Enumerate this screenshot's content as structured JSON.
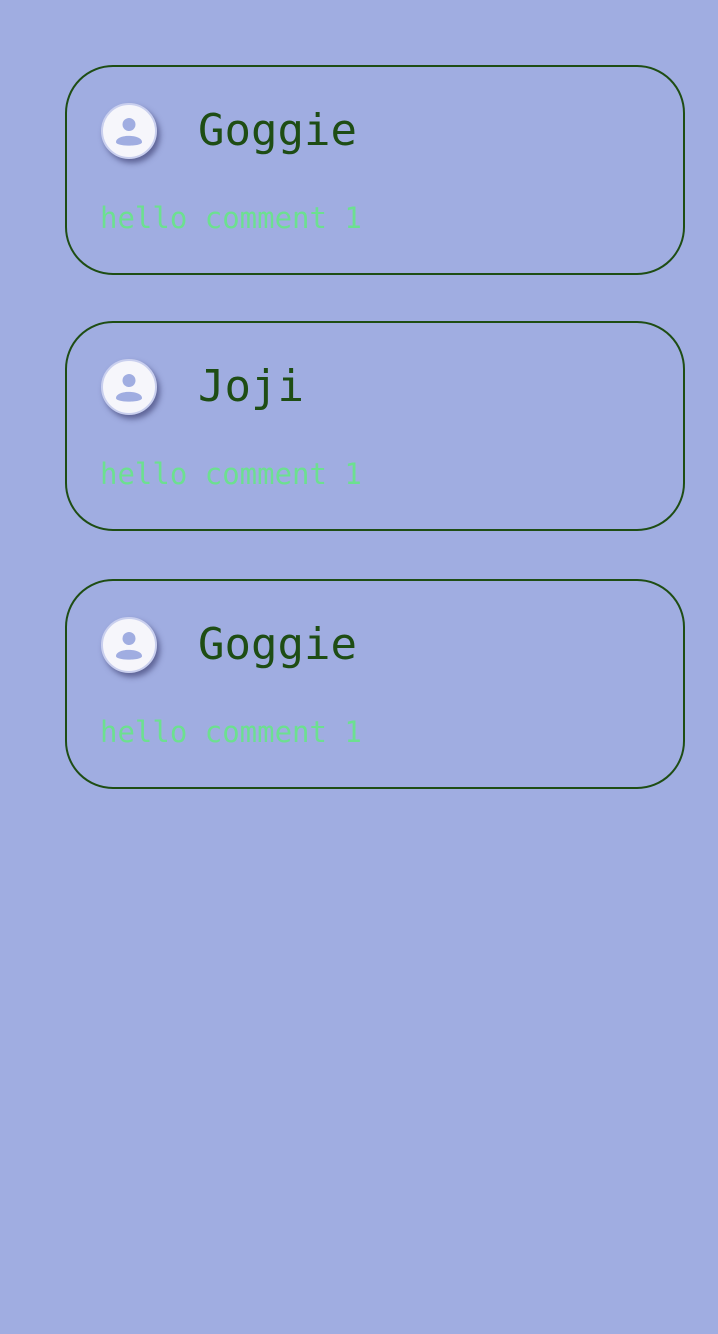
{
  "colors": {
    "background": "#a0ade1",
    "card_border": "#1e4d14",
    "author_name": "#1e4d14",
    "comment_text": "#6ce090",
    "avatar_icon": "#a0ade1"
  },
  "comments": [
    {
      "author": "Goggie",
      "text": "hello comment 1",
      "avatar_icon": "user-avatar-icon"
    },
    {
      "author": "Joji",
      "text": "hello comment 1",
      "avatar_icon": "user-avatar-icon"
    },
    {
      "author": "Goggie",
      "text": "hello comment 1",
      "avatar_icon": "user-avatar-icon"
    }
  ]
}
